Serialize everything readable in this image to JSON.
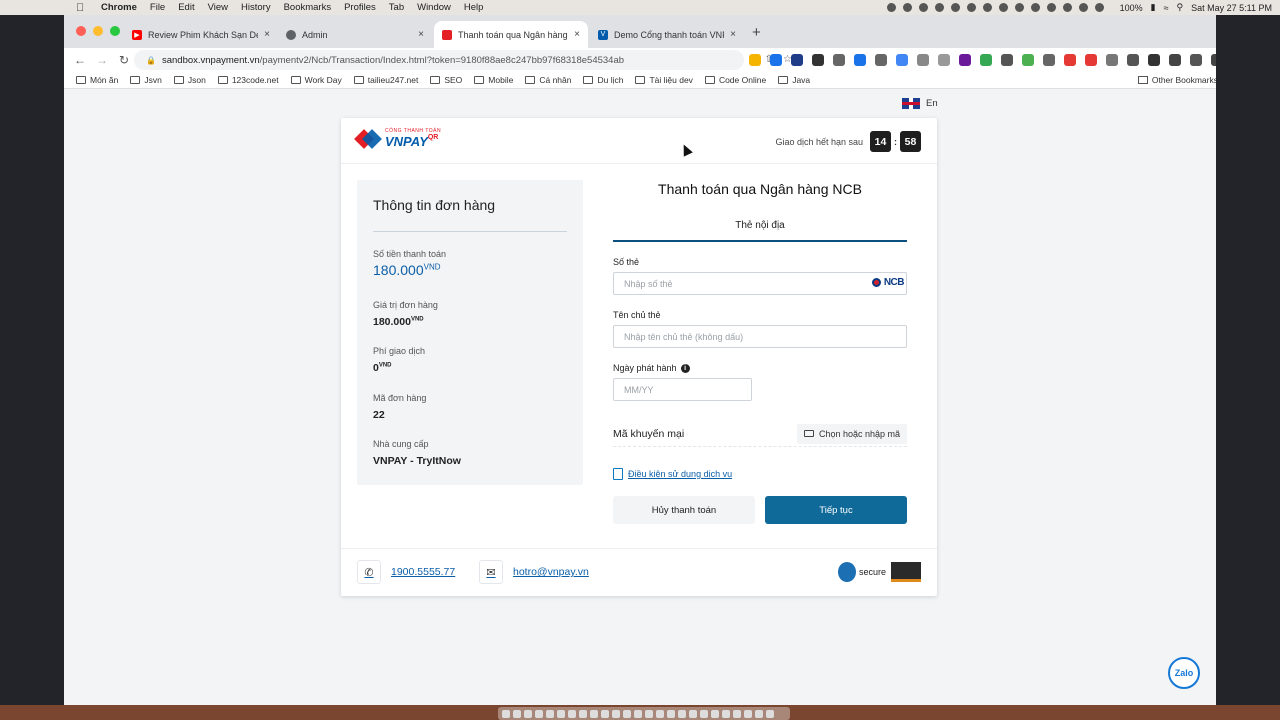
{
  "menubar": {
    "app": "Chrome",
    "items": [
      "File",
      "Edit",
      "View",
      "History",
      "Bookmarks",
      "Profiles",
      "Tab",
      "Window",
      "Help"
    ],
    "battery": "100%",
    "clock": "Sat May 27  5:11 PM"
  },
  "tabs": [
    {
      "title": "Review Phim Khách Sạn Del Lu",
      "color": "#ff0000"
    },
    {
      "title": "Admin",
      "color": "#5f6368"
    },
    {
      "title": "Thanh toán qua Ngân hàng NC",
      "color": "#e31e25"
    },
    {
      "title": "Demo Cổng thanh toán VNPAY",
      "color": "#005baa"
    }
  ],
  "omnibox": {
    "host": "sandbox.vnpayment.vn",
    "path": "/paymentv2/Ncb/Transaction/Index.html?token=9180f88ae8c247bb97f68318e54534ab"
  },
  "bookmarks": [
    "Món ăn",
    "Jsvn",
    "Json",
    "123code.net",
    "Work Day",
    "tailieu247.net",
    "SEO",
    "Mobile",
    "Cá nhân",
    "Du lịch",
    "Tài liệu dev",
    "Code Online",
    "Java"
  ],
  "bookmarks_other": "Other Bookmarks",
  "page": {
    "lang": "En",
    "logo_small": "CỔNG THANH TOÁN",
    "logo_big": "VNPAY",
    "logo_qr": "QR",
    "expire_label": "Giao dịch hết hạn sau",
    "timer_min": "14",
    "timer_sep": ":",
    "timer_sec": "58",
    "summary": {
      "title": "Thông tin đơn hàng",
      "amount_label": "Số tiền thanh toán",
      "amount": "180.000",
      "currency": "VND",
      "order_value_label": "Giá trị đơn hàng",
      "order_value": "180.000",
      "fee_label": "Phí giao dịch",
      "fee": "0",
      "order_id_label": "Mã đơn hàng",
      "order_id": "22",
      "provider_label": "Nhà cung cấp",
      "provider": "VNPAY - TryItNow"
    },
    "form": {
      "title": "Thanh toán qua Ngân hàng NCB",
      "tab": "Thẻ nội địa",
      "card_no_label": "Số thẻ",
      "card_no_placeholder": "Nhập số thẻ",
      "bank_badge": "NCB",
      "holder_label": "Tên chủ thẻ",
      "holder_placeholder": "Nhập tên chủ thẻ (không dấu)",
      "issue_label": "Ngày phát hành",
      "issue_info": "i",
      "issue_placeholder": "MM/YY",
      "promo_label": "Mã khuyến mại",
      "promo_button": "Chọn hoặc nhập mã",
      "terms": "Điều kiện sử dụng dịch vụ",
      "cancel": "Hủy thanh toán",
      "next": "Tiếp tục"
    },
    "footer": {
      "phone": "1900.5555.77",
      "email": "hotro@vnpay.vn",
      "secure": "secure"
    },
    "zalo": "Zalo"
  },
  "colors": {
    "brand_blue": "#005baa",
    "brand_red": "#e31e25",
    "primary_button": "#0f6a99"
  }
}
